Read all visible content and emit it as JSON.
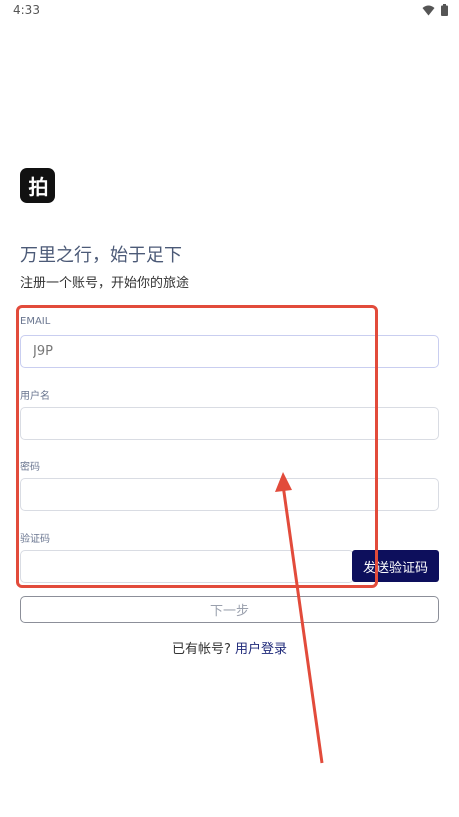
{
  "status_bar": {
    "time": "4:33",
    "wifi_icon": "wifi-icon",
    "battery_icon": "battery-icon"
  },
  "logo": {
    "text": "拍",
    "icon": "app-logo"
  },
  "heading": "万里之行，始于足下",
  "subheading": "注册一个账号，开始你的旅途",
  "form": {
    "email": {
      "label": "EMAIL",
      "value": "J9P"
    },
    "username": {
      "label": "用户名",
      "value": ""
    },
    "password": {
      "label": "密码",
      "value": ""
    },
    "code": {
      "label": "验证码",
      "value": ""
    },
    "send_code_label": "发送验证码"
  },
  "next_label": "下一步",
  "login": {
    "prompt": "已有帐号?",
    "link": "用户登录"
  },
  "colors": {
    "annotation": "#e24b3b",
    "primary": "#0d0f5c",
    "heading": "#4c5a77"
  }
}
